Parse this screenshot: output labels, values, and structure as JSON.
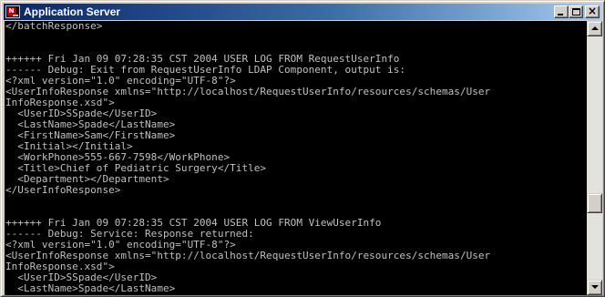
{
  "window": {
    "title": "Application Server",
    "icon": "console-app-icon",
    "icon_badge": "N",
    "controls": {
      "minimize": "minimize-icon",
      "maximize": "maximize-icon",
      "close_glyph": "×"
    }
  },
  "colors": {
    "title_bar_start": "#0a246a",
    "title_bar_end": "#a6caf0",
    "console_background": "#000000",
    "console_text": "#c0c0c0"
  },
  "console": {
    "lines": [
      "</batchResponse>",
      "",
      "",
      "++++++ Fri Jan 09 07:28:35 CST 2004 USER LOG FROM RequestUserInfo",
      "------ Debug: Exit from RequestUserInfo LDAP Component, output is:",
      "<?xml version=\"1.0\" encoding=\"UTF-8\"?>",
      "<UserInfoResponse xmlns=\"http://localhost/RequestUserInfo/resources/schemas/User",
      "InfoResponse.xsd\">",
      "  <UserID>SSpade</UserID>",
      "  <LastName>Spade</LastName>",
      "  <FirstName>Sam</FirstName>",
      "  <Initial></Initial>",
      "  <WorkPhone>555-667-7598</WorkPhone>",
      "  <Title>Chief of Pediatric Surgery</Title>",
      "  <Department></Department>",
      "</UserInfoResponse>",
      "",
      "",
      "++++++ Fri Jan 09 07:28:35 CST 2004 USER LOG FROM ViewUserInfo",
      "------ Debug: Service: Response returned:",
      "<?xml version=\"1.0\" encoding=\"UTF-8\"?>",
      "<UserInfoResponse xmlns=\"http://localhost/RequestUserInfo/resources/schemas/User",
      "InfoResponse.xsd\">",
      "  <UserID>SSpade</UserID>",
      "  <LastName>Spade</LastName>"
    ]
  },
  "scrollbar": {
    "up_icon": "scroll-up-arrow-icon",
    "down_icon": "scroll-down-arrow-icon",
    "position_fraction": 0.7
  }
}
